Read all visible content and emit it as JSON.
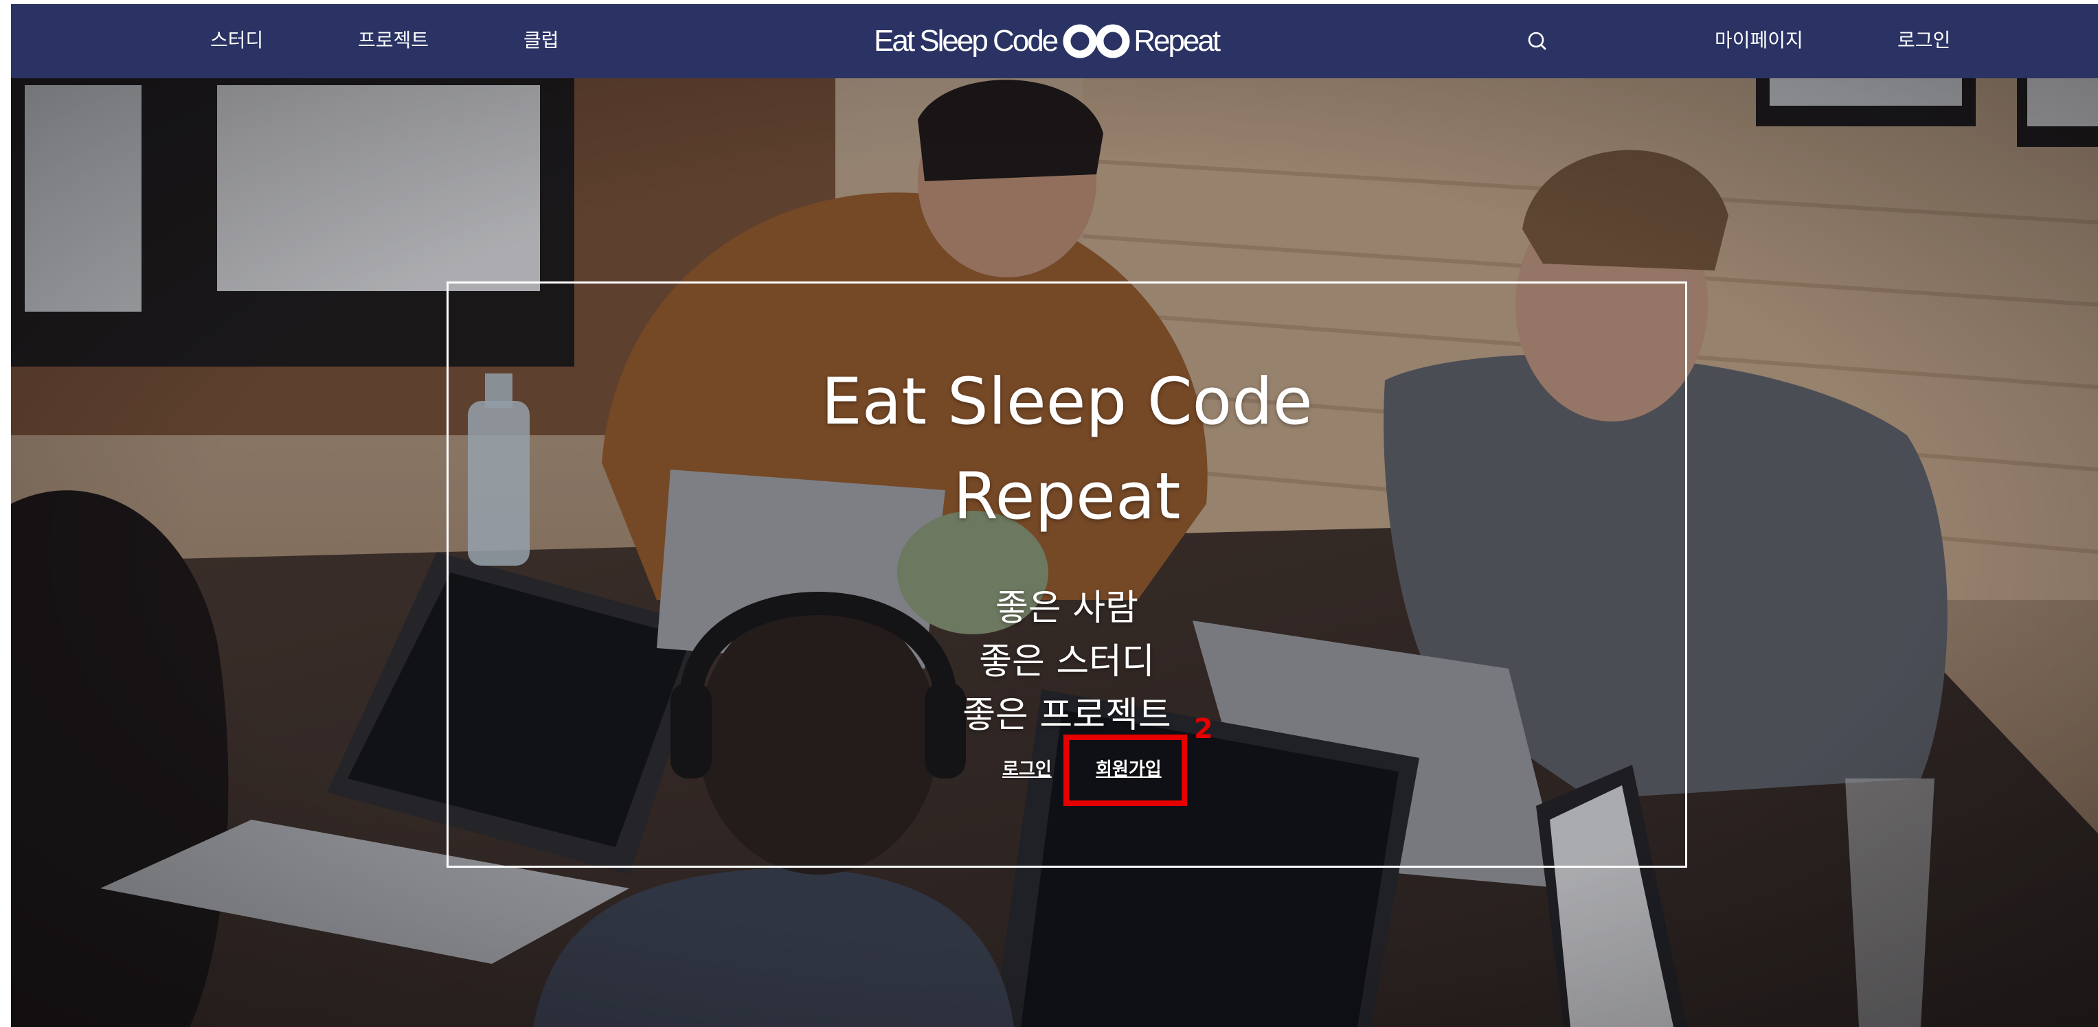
{
  "header": {
    "nav_left": [
      {
        "label": "스터디"
      },
      {
        "label": "프로젝트"
      },
      {
        "label": "클럽"
      }
    ],
    "logo": {
      "text_before": "Eat Sleep Code",
      "icon": "infinity-icon",
      "text_after": "Repeat"
    },
    "search_icon": "search-icon",
    "nav_right": [
      {
        "label": "마이페이지"
      },
      {
        "label": "로그인"
      }
    ],
    "background_color": "#2b3364"
  },
  "hero": {
    "title_line1": "Eat Sleep Code",
    "title_line2": "Repeat",
    "subtitle": [
      "좋은 사람",
      "좋은 스터디",
      "좋은 프로젝트"
    ],
    "login_link": "로그인",
    "signup_link": "회원가입",
    "annotation_number": "2",
    "annotation_color": "#e60000"
  }
}
